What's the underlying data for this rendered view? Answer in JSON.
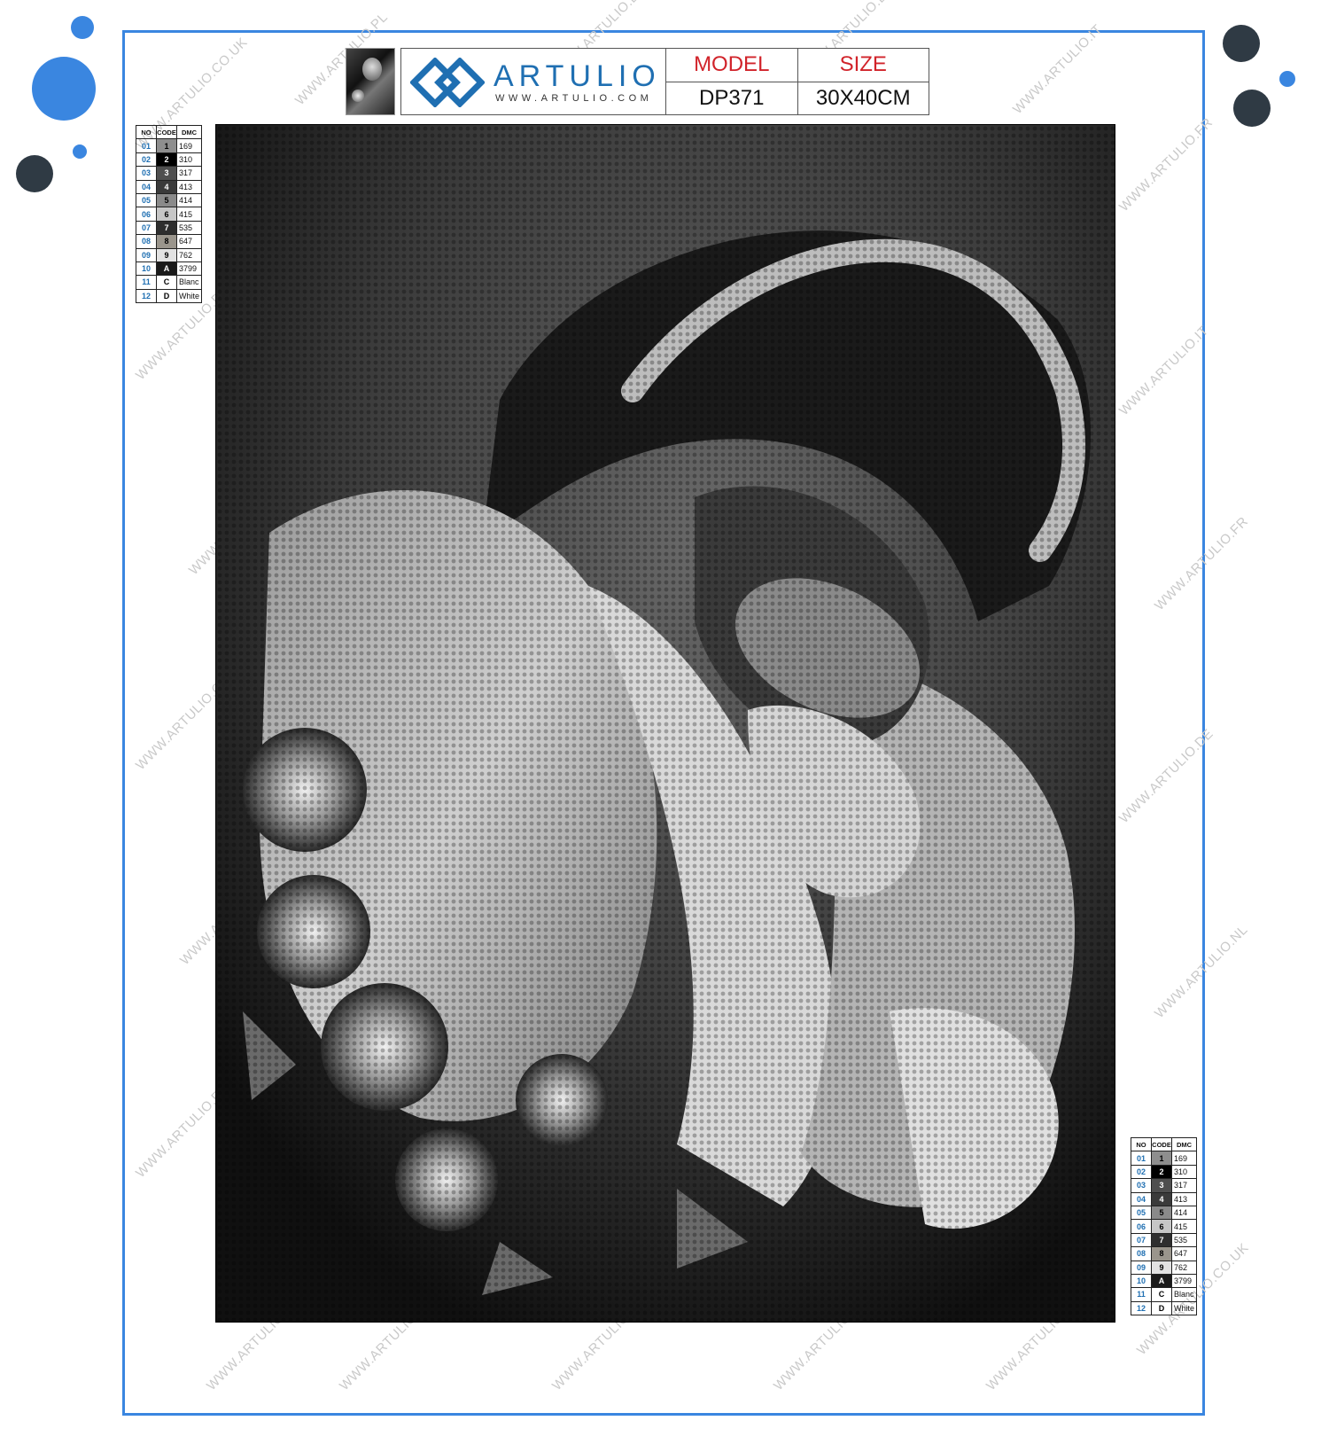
{
  "header": {
    "brand": "ARTULIO",
    "brand_url": "WWW.ARTULIO.COM",
    "model_label": "MODEL",
    "model_value": "DP371",
    "size_label": "SIZE",
    "size_value": "30X40CM"
  },
  "legend": {
    "headers": [
      "NO",
      "CODE",
      "DMC"
    ],
    "rows": [
      {
        "no": "01",
        "code": "1",
        "dmc": "169",
        "swatch": "#8e8e8e"
      },
      {
        "no": "02",
        "code": "2",
        "dmc": "310",
        "swatch": "#000000"
      },
      {
        "no": "03",
        "code": "3",
        "dmc": "317",
        "swatch": "#4f4f4f"
      },
      {
        "no": "04",
        "code": "4",
        "dmc": "413",
        "swatch": "#3a3a3a"
      },
      {
        "no": "05",
        "code": "5",
        "dmc": "414",
        "swatch": "#8a8a8a"
      },
      {
        "no": "06",
        "code": "6",
        "dmc": "415",
        "swatch": "#c6c6c6"
      },
      {
        "no": "07",
        "code": "7",
        "dmc": "535",
        "swatch": "#2e2e2e"
      },
      {
        "no": "08",
        "code": "8",
        "dmc": "647",
        "swatch": "#9a958c"
      },
      {
        "no": "09",
        "code": "9",
        "dmc": "762",
        "swatch": "#e2e2e2"
      },
      {
        "no": "10",
        "code": "A",
        "dmc": "3799",
        "swatch": "#1a1a1a"
      },
      {
        "no": "11",
        "code": "C",
        "dmc": "Blanc",
        "swatch": "#ffffff"
      },
      {
        "no": "12",
        "code": "D",
        "dmc": "White",
        "swatch": "#ffffff"
      }
    ]
  },
  "watermarks": [
    "WWW.ARTULIO.CO.UK",
    "WWW.ARTULIO.PL",
    "WWW.ARTULIO.EU",
    "WWW.ARTULIO.ES",
    "WWW.ARTULIO.IT",
    "WWW.ARTULIO.FR",
    "WWW.ARTULIO.DE",
    "WWW.ARTULIO.NL"
  ],
  "colors": {
    "accent": "#3a86e0",
    "dot_blue": "#3a86e0",
    "dot_dark": "#2f3a44",
    "label_red": "#d1232a",
    "brand_blue": "#1f6fb2"
  }
}
